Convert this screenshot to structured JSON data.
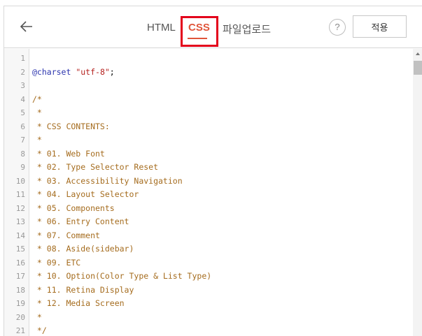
{
  "tabs": {
    "html": "HTML",
    "css": "CSS",
    "upload": "파일업로드"
  },
  "toolbar": {
    "help_label": "?",
    "apply_label": "적용"
  },
  "editor": {
    "lines": [
      {
        "n": "1",
        "segments": []
      },
      {
        "n": "2",
        "segments": [
          {
            "t": "@charset",
            "c": "kw"
          },
          {
            "t": " ",
            "c": ""
          },
          {
            "t": "\"utf-8\"",
            "c": "str"
          },
          {
            "t": ";",
            "c": ""
          }
        ]
      },
      {
        "n": "3",
        "segments": []
      },
      {
        "n": "4",
        "segments": [
          {
            "t": "/*",
            "c": "cm"
          }
        ]
      },
      {
        "n": "5",
        "segments": [
          {
            "t": " *",
            "c": "cm"
          }
        ]
      },
      {
        "n": "6",
        "segments": [
          {
            "t": " * CSS CONTENTS:",
            "c": "cm"
          }
        ]
      },
      {
        "n": "7",
        "segments": [
          {
            "t": " *",
            "c": "cm"
          }
        ]
      },
      {
        "n": "8",
        "segments": [
          {
            "t": " * 01. Web Font",
            "c": "cm"
          }
        ]
      },
      {
        "n": "9",
        "segments": [
          {
            "t": " * 02. Type Selector Reset",
            "c": "cm"
          }
        ]
      },
      {
        "n": "10",
        "segments": [
          {
            "t": " * 03. Accessibility Navigation",
            "c": "cm"
          }
        ]
      },
      {
        "n": "11",
        "segments": [
          {
            "t": " * 04. Layout Selector",
            "c": "cm"
          }
        ]
      },
      {
        "n": "12",
        "segments": [
          {
            "t": " * 05. Components",
            "c": "cm"
          }
        ]
      },
      {
        "n": "13",
        "segments": [
          {
            "t": " * 06. Entry Content",
            "c": "cm"
          }
        ]
      },
      {
        "n": "14",
        "segments": [
          {
            "t": " * 07. Comment",
            "c": "cm"
          }
        ]
      },
      {
        "n": "15",
        "segments": [
          {
            "t": " * 08. Aside(sidebar)",
            "c": "cm"
          }
        ]
      },
      {
        "n": "16",
        "segments": [
          {
            "t": " * 09. ETC",
            "c": "cm"
          }
        ]
      },
      {
        "n": "17",
        "segments": [
          {
            "t": " * 10. Option(Color Type & List Type)",
            "c": "cm"
          }
        ]
      },
      {
        "n": "18",
        "segments": [
          {
            "t": " * 11. Retina Display",
            "c": "cm"
          }
        ]
      },
      {
        "n": "19",
        "segments": [
          {
            "t": " * 12. Media Screen",
            "c": "cm"
          }
        ]
      },
      {
        "n": "20",
        "segments": [
          {
            "t": " *",
            "c": "cm"
          }
        ]
      },
      {
        "n": "21",
        "segments": [
          {
            "t": " */",
            "c": "cm"
          }
        ]
      }
    ]
  },
  "icons": {
    "back": "arrow-left-icon",
    "help": "question-icon"
  },
  "colors": {
    "active_tab": "#e0553a",
    "highlight": "#e3001b",
    "keyword": "#2b34ae",
    "string": "#b5221f",
    "comment": "#a56c1e"
  }
}
